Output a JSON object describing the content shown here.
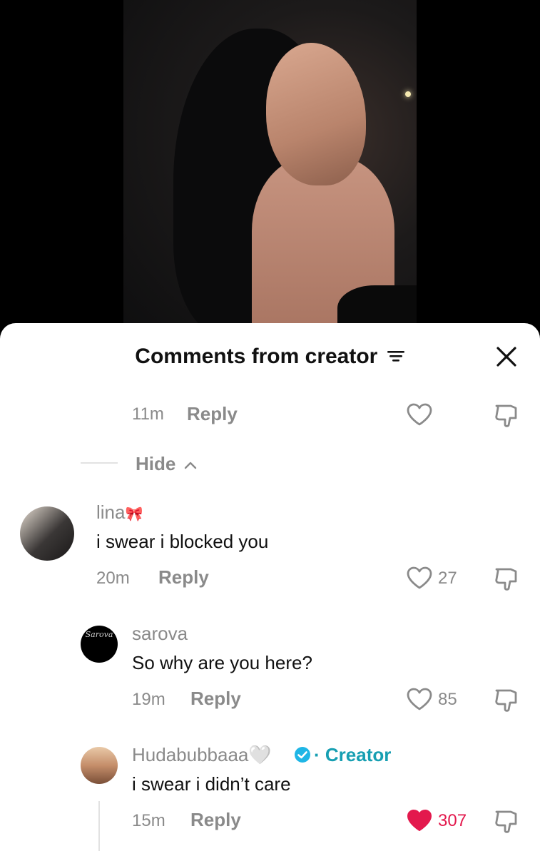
{
  "video": {
    "alt": "video frame"
  },
  "sheet": {
    "title": "Comments from creator",
    "close_icon": "close-icon",
    "filter_icon": "filter-icon"
  },
  "top_item": {
    "time": "11m",
    "reply": "Reply"
  },
  "hide": {
    "label": "Hide"
  },
  "comments": [
    {
      "user": "lina",
      "user_suffix": "🎀",
      "text": "i swear i blocked you",
      "time": "20m",
      "reply": "Reply",
      "likes": "27",
      "liked": false
    },
    {
      "user": "sarova",
      "avatar_text": "Sarova",
      "text": "So why are you here?",
      "time": "19m",
      "reply": "Reply",
      "likes": "85",
      "liked": false
    },
    {
      "user": "Hudabubbaaa🤍",
      "badge": "· Creator",
      "text": "i swear i didn’t care",
      "time": "15m",
      "reply": "Reply",
      "likes": "307",
      "liked": true
    }
  ],
  "colors": {
    "liked": "#e3194d",
    "verified": "#1fb6e6",
    "creator": "#179fb2"
  }
}
